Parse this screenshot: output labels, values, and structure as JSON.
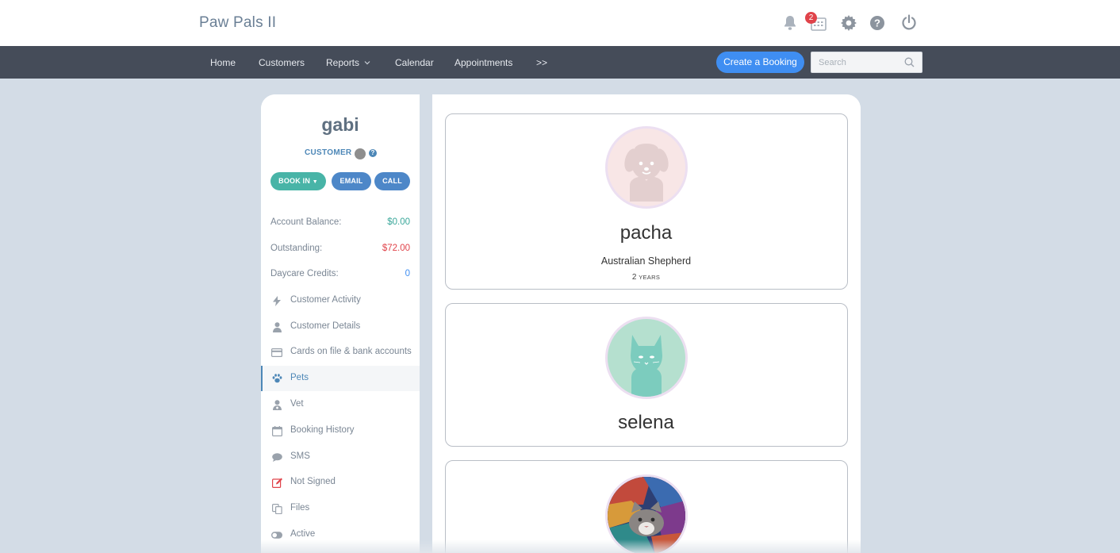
{
  "header": {
    "brand": "Paw Pals II",
    "notification_count": "2",
    "icons": [
      "bell-icon",
      "calendar-grid-icon",
      "gear-icon",
      "help-icon",
      "power-icon"
    ]
  },
  "nav": {
    "items": [
      "Home",
      "Customers",
      "Reports",
      "Calendar",
      "Appointments",
      ">>"
    ],
    "create_label": "Create a Booking",
    "search_placeholder": "Search"
  },
  "customer": {
    "name": "gabi",
    "type": "CUSTOMER",
    "actions": {
      "book_in": "BOOK IN",
      "email": "EMAIL",
      "call": "CALL"
    },
    "stats": [
      {
        "label": "Account Balance:",
        "value": "$0.00",
        "color": "#3aa79a"
      },
      {
        "label": "Outstanding:",
        "value": "$72.00",
        "color": "#e0434a"
      },
      {
        "label": "Daycare Credits:",
        "value": "0",
        "color": "#3f8ef2"
      }
    ],
    "menu": [
      {
        "label": "Customer Activity",
        "icon": "bolt-icon"
      },
      {
        "label": "Customer Details",
        "icon": "user-icon"
      },
      {
        "label": "Cards on file & bank accounts",
        "icon": "credit-card-icon"
      },
      {
        "label": "Pets",
        "icon": "paw-icon",
        "active": true
      },
      {
        "label": "Vet",
        "icon": "doctor-icon"
      },
      {
        "label": "Booking History",
        "icon": "calendar-icon"
      },
      {
        "label": "SMS",
        "icon": "chat-bubble-icon"
      },
      {
        "label": "Not Signed",
        "icon": "edit-icon"
      },
      {
        "label": "Files",
        "icon": "files-icon"
      },
      {
        "label": "Active",
        "icon": "toggle-icon"
      }
    ]
  },
  "pets": [
    {
      "name": "pacha",
      "breed": "Australian Shepherd",
      "age": "2",
      "age_unit": "YEARS",
      "avatar": "dog-avatar"
    },
    {
      "name": "selena",
      "breed": "",
      "age": "",
      "age_unit": "",
      "avatar": "cat-avatar"
    },
    {
      "name": "",
      "breed": "",
      "age": "",
      "age_unit": "",
      "avatar": "cat-photo"
    }
  ],
  "colors": {
    "nav_bg": "#454c59",
    "primary": "#3f8ef2",
    "teal": "#48b4a7",
    "page_bg": "#d3dce6"
  }
}
